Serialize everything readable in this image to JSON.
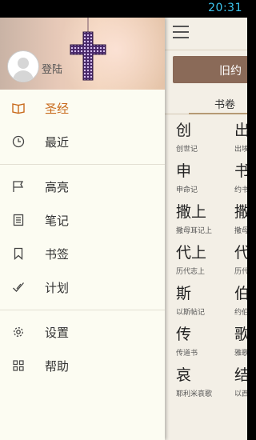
{
  "status_bar": {
    "time": "20:31"
  },
  "drawer": {
    "login_label": "登陆",
    "groups": [
      [
        {
          "label": "圣经",
          "icon": "book-icon",
          "active": true
        },
        {
          "label": "最近",
          "icon": "clock-icon",
          "active": false
        }
      ],
      [
        {
          "label": "高亮",
          "icon": "flag-icon",
          "active": false
        },
        {
          "label": "笔记",
          "icon": "note-icon",
          "active": false
        },
        {
          "label": "书签",
          "icon": "bookmark-icon",
          "active": false
        },
        {
          "label": "计划",
          "icon": "check-icon",
          "active": false
        }
      ],
      [
        {
          "label": "设置",
          "icon": "gear-icon",
          "active": false
        },
        {
          "label": "帮助",
          "icon": "grid-icon",
          "active": false
        }
      ]
    ]
  },
  "main": {
    "segment_label": "旧约",
    "tab_label": "书卷",
    "books": [
      {
        "abbr": "创",
        "name": "创世记"
      },
      {
        "abbr": "出",
        "name": "出埃"
      },
      {
        "abbr": "申",
        "name": "申命记"
      },
      {
        "abbr": "书",
        "name": "约书"
      },
      {
        "abbr": "撒上",
        "name": "撒母耳记上"
      },
      {
        "abbr": "撒",
        "name": "撒母"
      },
      {
        "abbr": "代上",
        "name": "历代志上"
      },
      {
        "abbr": "代",
        "name": "历代"
      },
      {
        "abbr": "斯",
        "name": "以斯帖记"
      },
      {
        "abbr": "伯",
        "name": "约伯"
      },
      {
        "abbr": "传",
        "name": "传道书"
      },
      {
        "abbr": "歌",
        "name": "雅歌"
      },
      {
        "abbr": "哀",
        "name": "耶利米哀歌"
      },
      {
        "abbr": "结",
        "name": "以西"
      }
    ]
  },
  "colors": {
    "accent": "#c86a1c",
    "segment": "#8a6a58",
    "status_time": "#3cc6f0"
  }
}
